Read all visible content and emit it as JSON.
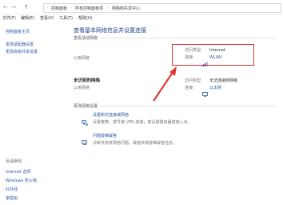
{
  "address_bar": {
    "back": "←",
    "forward": "→",
    "up": "↑",
    "path": [
      "控制面板",
      "所有控制面板项",
      "网络和共享中心"
    ]
  },
  "menu": [
    "文件(F)",
    "编辑(E)",
    "查看(V)",
    "工具(T)",
    "帮助(H)"
  ],
  "left_pane": {
    "links": [
      "控制面板主页",
      "更改适配器设置",
      "更改高级共享设置"
    ],
    "see_also_title": "另请参阅",
    "see_also": [
      "Internet 选项",
      "Windows 防火墙",
      "红外线",
      "家庭组"
    ]
  },
  "main": {
    "title": "查看基本网络信息并设置连接",
    "active_networks_label": "查看活动网络",
    "network1": {
      "name": "",
      "type": "公用网络",
      "access_type_label": "访问类型:",
      "access_type_value": "Internet",
      "connection_label": "连接:",
      "connection_value": "WLAN"
    },
    "network2": {
      "name": "未识别的网络",
      "type": "公用网络",
      "access_type_label": "访问类型:",
      "access_type_value": "无法连接到网络",
      "connection_label": "连接:",
      "connection_value": "以太网"
    },
    "change_settings_label": "更改网络设置",
    "task1": {
      "title": "设置新的连接或网络",
      "desc": "设置宽带、拨号或 VPN 连接；或设置路由器或接入点。"
    },
    "task2": {
      "title": "问题疑难解答",
      "desc": "诊断并修复网络问题，或者获得疑难解答信息。"
    }
  },
  "colors": {
    "highlight": "#e0383a",
    "link": "#2b5aa5",
    "title": "#1f3f8f"
  }
}
